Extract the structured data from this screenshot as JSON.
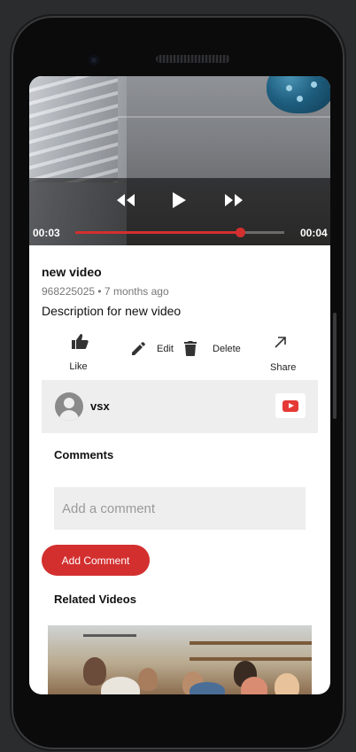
{
  "video": {
    "current_time": "00:03",
    "duration": "00:04",
    "progress": 0.79
  },
  "details": {
    "title": "new video",
    "meta": "968225025 • 7 months ago",
    "description": "Description for new video"
  },
  "actions": {
    "like": "Like",
    "edit": "Edit",
    "delete": "Delete",
    "share": "Share"
  },
  "channel": {
    "name": "vsx"
  },
  "comments": {
    "heading": "Comments",
    "placeholder": "Add a comment",
    "value": "",
    "add_label": "Add Comment"
  },
  "related": {
    "heading": "Related Videos"
  },
  "colors": {
    "accent": "#d32f2f",
    "youtube_red": "#e53935",
    "panel": "#eeeeee"
  }
}
